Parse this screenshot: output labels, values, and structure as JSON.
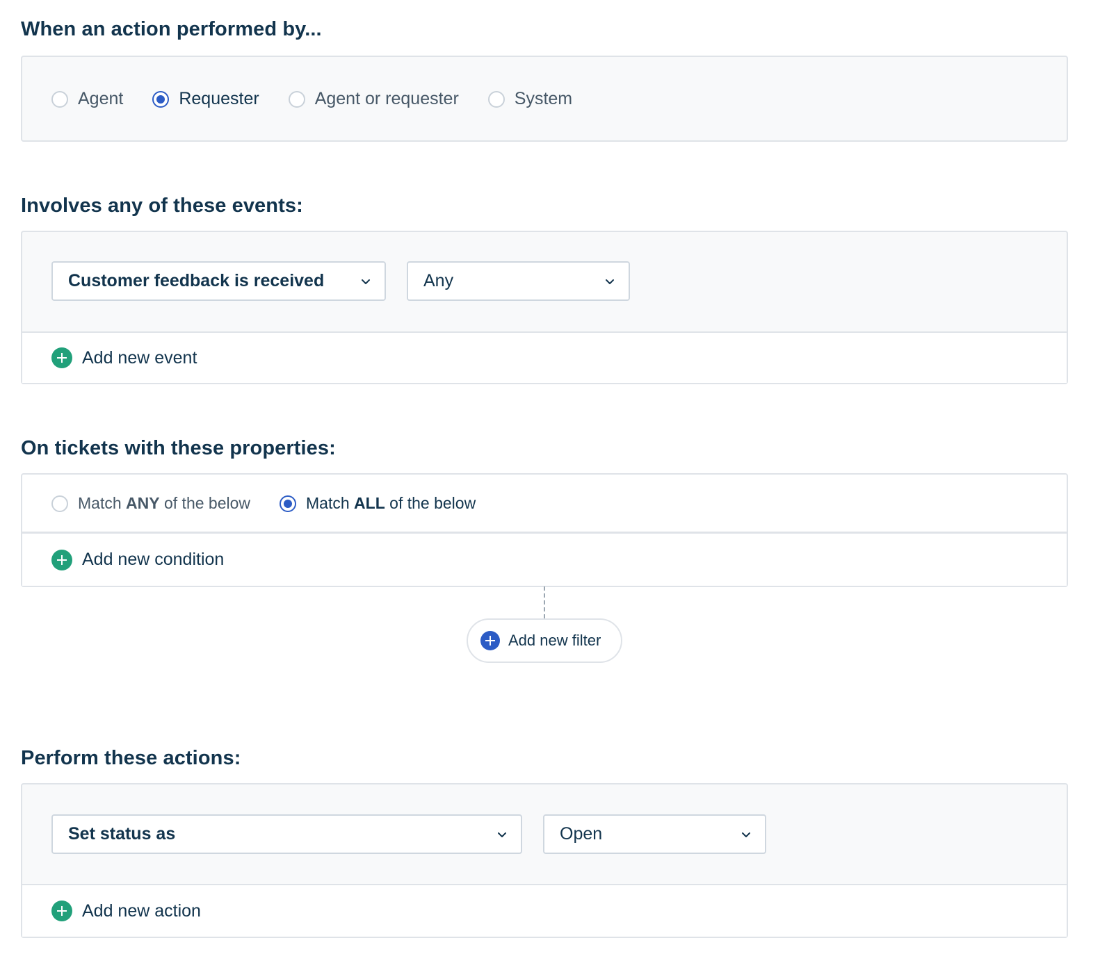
{
  "performer": {
    "title": "When an action performed by...",
    "options": [
      {
        "label": "Agent",
        "selected": false
      },
      {
        "label": "Requester",
        "selected": true
      },
      {
        "label": "Agent or requester",
        "selected": false
      },
      {
        "label": "System",
        "selected": false
      }
    ]
  },
  "events": {
    "title": "Involves any of these events:",
    "event_select": "Customer feedback is received",
    "value_select": "Any",
    "add_label": "Add new event"
  },
  "properties": {
    "title": "On tickets with these properties:",
    "match_any": {
      "prefix": "Match ",
      "strong": "ANY",
      "suffix": " of the below",
      "selected": false
    },
    "match_all": {
      "prefix": "Match ",
      "strong": "ALL",
      "suffix": " of the below",
      "selected": true
    },
    "add_condition_label": "Add new condition",
    "add_filter_label": "Add new filter"
  },
  "actions": {
    "title": "Perform these actions:",
    "action_select": "Set status as",
    "value_select": "Open",
    "add_label": "Add new action"
  },
  "colors": {
    "primary_text": "#12344d",
    "accent_blue": "#2c5cc5",
    "add_green": "#21a07a",
    "panel_bg": "#f8f9fa",
    "border": "#dfe3e8"
  },
  "icons": {
    "dropdown": "chevron-down-icon",
    "add": "plus-circle-icon"
  }
}
